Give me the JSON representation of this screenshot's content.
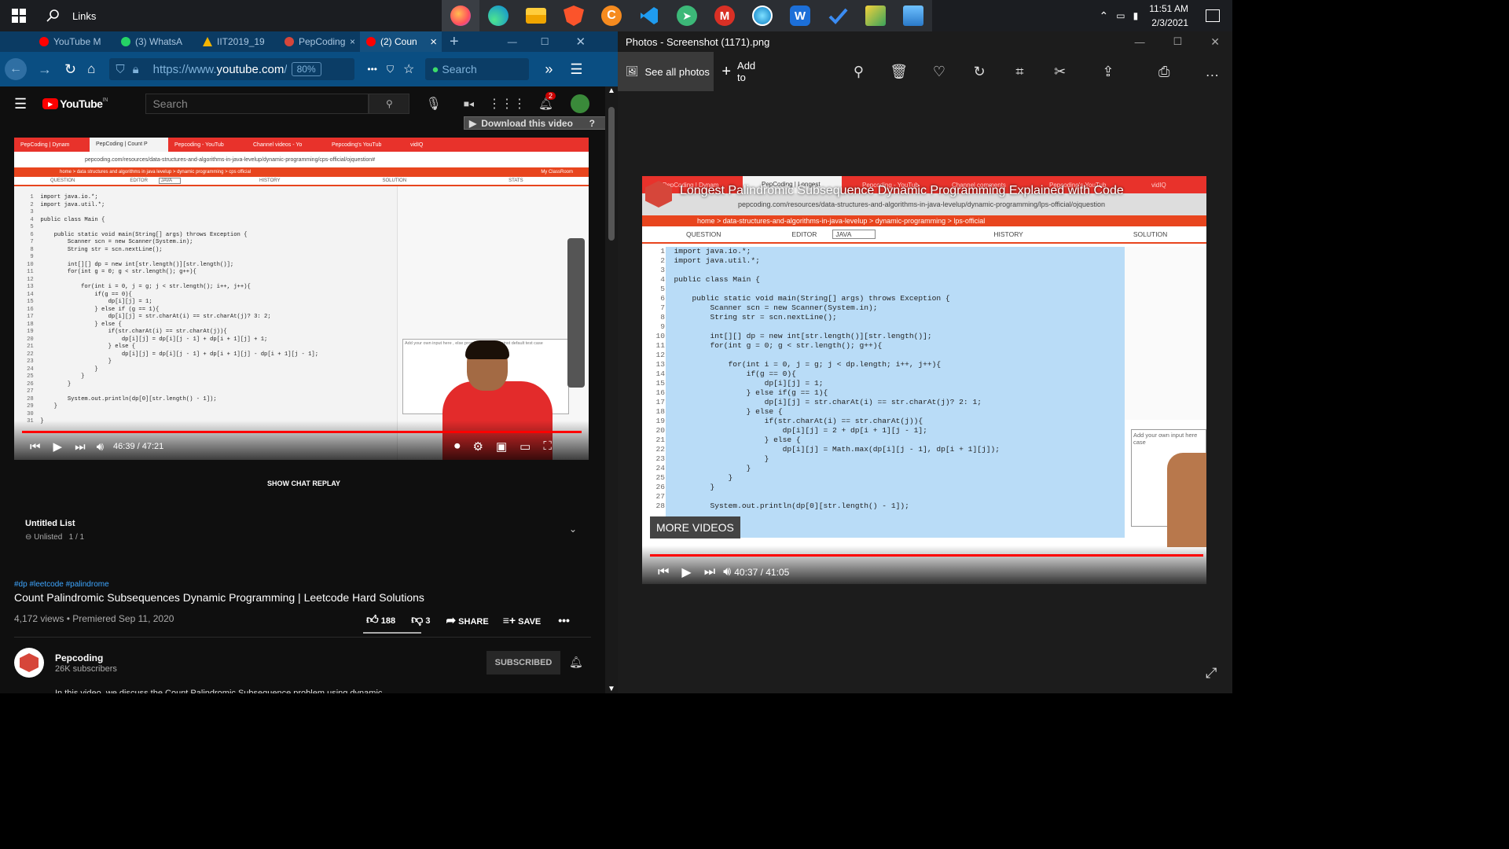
{
  "taskbar": {
    "search_label": "Links",
    "time": "11:51 AM",
    "date": "2/3/2021"
  },
  "firefox": {
    "tabs": [
      "YouTube M",
      "(3) WhatsA",
      "IIT2019_19",
      "PepCoding",
      "(2) Coun"
    ],
    "url_prefix": "https://www.",
    "url_domain": "youtube.com",
    "url_suffix": "/w",
    "zoom": "80%",
    "search_placeholder": "Search"
  },
  "youtube": {
    "logo": "YouTube",
    "logo_region": "IN",
    "search_placeholder": "Search",
    "notif_count": "2",
    "download_label": "Download this video",
    "video_time": "46:39 / 47:21",
    "chat_replay": "SHOW CHAT REPLAY",
    "playlist_title": "Untitled List",
    "playlist_status": "Unlisted",
    "playlist_pos": "1 / 1",
    "hashtags": "#dp #leetcode #palindrome",
    "title": "Count Palindromic Subsequences Dynamic Programming | Leetcode Hard Solutions",
    "meta": "4,172 views • Premiered Sep 11, 2020",
    "likes": "188",
    "dislikes": "3",
    "share": "SHARE",
    "save": "SAVE",
    "channel": "Pepcoding",
    "subs": "26K subscribers",
    "subscribed": "SUBSCRIBED",
    "desc": "In this video, we discuss the Count Palindromic Subsequence problem using dynamic"
  },
  "inner_left": {
    "tabs": [
      "PepCoding | Dynam",
      "PepCoding | Count P",
      "Pepcoding - YouTub",
      "Channel videos - Yo",
      "Pepcoding's YouTub",
      "vidIQ"
    ],
    "url": "pepcoding.com/resources/data-structures-and-algorithms-in-java-levelup/dynamic-programming/cps-official/ojquestion#",
    "breadcrumb": "home > data structures and algorithms in java levelup > dynamic programming > cps official",
    "classroom": "My ClassRoom",
    "editor_tabs": [
      "QUESTION",
      "EDITOR",
      "HISTORY",
      "SOLUTION",
      "STATS"
    ],
    "lang": "JAVA",
    "input_hint": "Add your own input here , else program will run against default test case",
    "code": [
      "import java.io.*;",
      "import java.util.*;",
      "",
      "public class Main {",
      "",
      "    public static void main(String[] args) throws Exception {",
      "        Scanner scn = new Scanner(System.in);",
      "        String str = scn.nextLine();",
      "",
      "        int[][] dp = new int[str.length()][str.length()];",
      "        for(int g = 0; g < str.length(); g++){",
      "",
      "            for(int i = 0, j = g; j < str.length(); i++, j++){",
      "                if(g == 0){",
      "                    dp[i][j] = 1;",
      "                } else if (g == 1){",
      "                    dp[i][j] = str.charAt(i) == str.charAt(j)? 3: 2;",
      "                } else {",
      "                    if(str.charAt(i) == str.charAt(j)){",
      "                        dp[i][j] = dp[i][j - 1] + dp[i + 1][j] + 1;",
      "                    } else {",
      "                        dp[i][j] = dp[i][j - 1] + dp[i + 1][j] - dp[i + 1][j - 1];",
      "                    }",
      "                }",
      "            }",
      "        }",
      "",
      "        System.out.println(dp[0][str.length() - 1]);",
      "    }",
      "",
      "}"
    ]
  },
  "photos": {
    "title": "Photos - Screenshot (1171).png",
    "see_all": "See all photos",
    "add_to": "Add to",
    "video_title": "Longest Palindromic Subsequence Dynamic Programming Explained with Code",
    "tabs": [
      "PepCoding | Dynam",
      "PepCoding | Longest",
      "Pepcoding - YouTub",
      "Channel comments",
      "Pepcoding's YouTub",
      "vidIQ"
    ],
    "url": "pepcoding.com/resources/data-structures-and-algorithms-in-java-levelup/dynamic-programming/lps-official/ojquestion",
    "breadcrumb": "home > data-structures-and-algorithms-in-java-levelup > dynamic-programming > lps-official",
    "editor_tabs": [
      "QUESTION",
      "EDITOR",
      "HISTORY",
      "SOLUTION"
    ],
    "lang": "JAVA",
    "input_hint": "Add your own input here case",
    "more_videos": "MORE VIDEOS",
    "video_time": "40:37 / 41:05",
    "code": [
      "import java.io.*;",
      "import java.util.*;",
      "",
      "public class Main {",
      "",
      "    public static void main(String[] args) throws Exception {",
      "        Scanner scn = new Scanner(System.in);",
      "        String str = scn.nextLine();",
      "",
      "        int[][] dp = new int[str.length()][str.length()];",
      "        for(int g = 0; g < str.length(); g++){",
      "",
      "            for(int i = 0, j = g; j < dp.length; i++, j++){",
      "                if(g == 0){",
      "                    dp[i][j] = 1;",
      "                } else if(g == 1){",
      "                    dp[i][j] = str.charAt(i) == str.charAt(j)? 2: 1;",
      "                } else {",
      "                    if(str.charAt(i) == str.charAt(j)){",
      "                        dp[i][j] = 2 + dp[i + 1][j - 1];",
      "                    } else {",
      "                        dp[i][j] = Math.max(dp[i][j - 1], dp[i + 1][j]);",
      "                    }",
      "                }",
      "            }",
      "        }",
      "",
      "        System.out.println(dp[0][str.length() - 1]);"
    ]
  },
  "colors": {
    "accent_red": "#ff0000",
    "taskbar": "#1b1d21",
    "ff_nav": "#0a4e82",
    "pep_orange": "#e8451e",
    "selection": "#b9dcf7"
  }
}
